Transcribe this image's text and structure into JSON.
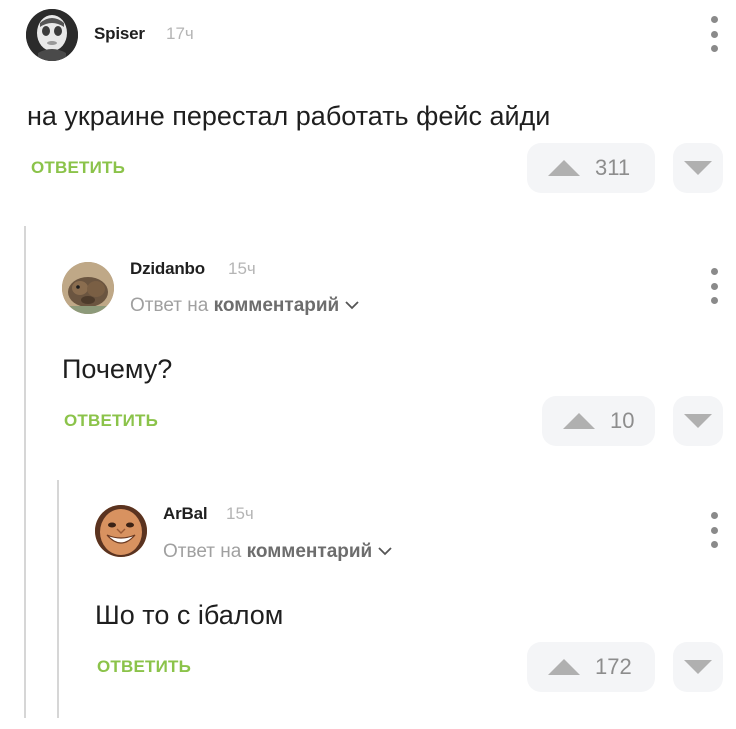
{
  "comments": [
    {
      "username": "Spiser",
      "time": "17ч",
      "text": "на украине перестал работать фейс айди",
      "reply_label": "ОТВЕТИТЬ",
      "votes": "311",
      "avatar_icon": "masked-face-avatar"
    },
    {
      "username": "Dzidanbo",
      "time": "15ч",
      "reply_to_prefix": "Ответ на",
      "reply_to_target": "комментарий",
      "text": "Почему?",
      "reply_label": "ОТВЕТИТЬ",
      "votes": "10",
      "avatar_icon": "animal-avatar"
    },
    {
      "username": "ArBal",
      "time": "15ч",
      "reply_to_prefix": "Ответ на",
      "reply_to_target": "комментарий",
      "text": "Шо то с iбалом",
      "reply_label": "ОТВЕТИТЬ",
      "votes": "172",
      "avatar_icon": "grinning-face-avatar"
    }
  ],
  "colors": {
    "accent_green": "#8bc34a",
    "vote_bg": "#f4f5f7",
    "muted": "#a0a0a0",
    "thread_line": "#d6d6d6"
  }
}
